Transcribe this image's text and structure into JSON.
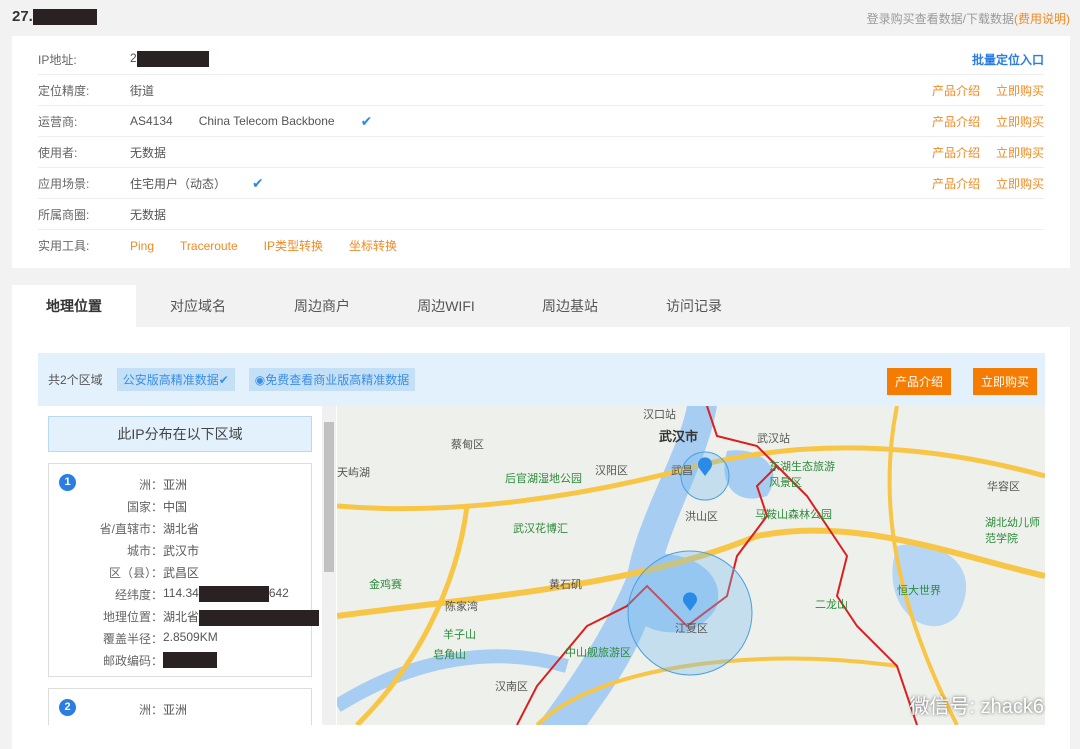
{
  "header": {
    "title": "27.",
    "right_text": "登录购买查看数据/下载数据",
    "right_link": "(费用说明)"
  },
  "info": {
    "batch_link": "批量定位入口",
    "product_intro": "产品介绍",
    "buy_now": "立即购买",
    "rows": [
      {
        "label": "IP地址:",
        "value": "2"
      },
      {
        "label": "定位精度:",
        "value": "街道"
      },
      {
        "label": "运营商:",
        "value": "AS4134",
        "value2": "China Telecom Backbone"
      },
      {
        "label": "使用者:",
        "value": "无数据"
      },
      {
        "label": "应用场景:",
        "value": "住宅用户（动态）"
      },
      {
        "label": "所属商圈:",
        "value": "无数据"
      },
      {
        "label": "实用工具:",
        "tools": [
          "Ping",
          "Traceroute",
          "IP类型转换",
          "坐标转换"
        ]
      }
    ]
  },
  "tabs": [
    "地理位置",
    "对应域名",
    "周边商户",
    "周边WIFI",
    "周边基站",
    "访问记录"
  ],
  "bar": {
    "count": "共2个区域",
    "chip1": "公安版高精准数据✔",
    "chip2": "免费查看商业版高精准数据",
    "product_intro": "产品介绍",
    "buy_now": "立即购买"
  },
  "list": {
    "heading": "此IP分布在以下区域",
    "item1": {
      "num": "1",
      "fields": [
        [
          "洲：",
          "亚洲"
        ],
        [
          "国家：",
          "中国"
        ],
        [
          "省/直辖市：",
          "湖北省"
        ],
        [
          "城市：",
          "武汉市"
        ],
        [
          "区（县）：",
          "武昌区"
        ],
        [
          "经纬度：",
          "114.34",
          "642"
        ],
        [
          "地理位置：",
          "湖北省"
        ],
        [
          "覆盖半径：",
          "2.8509KM"
        ],
        [
          "邮政编码：",
          ""
        ]
      ]
    },
    "item2": {
      "num": "2",
      "fields": [
        [
          "洲：",
          "亚洲"
        ]
      ]
    }
  },
  "map": {
    "labels": [
      "武汉市",
      "汉阳区",
      "洪山区",
      "江夏区",
      "东湖生态旅游风景区",
      "马鞍山森林公园",
      "后官湖湿地公园",
      "武汉花博汇",
      "蔡甸区",
      "天屿湖",
      "金鸡赛",
      "羊子山",
      "皂角山",
      "中山舰旅游区",
      "汉南区",
      "二龙山",
      "恒大世界",
      "华容区",
      "湖北幼儿师范学院",
      "武昌",
      "黄石矶",
      "陈家湾",
      "武汉站",
      "汉口站"
    ],
    "watermark": "微信号: zhack6"
  }
}
